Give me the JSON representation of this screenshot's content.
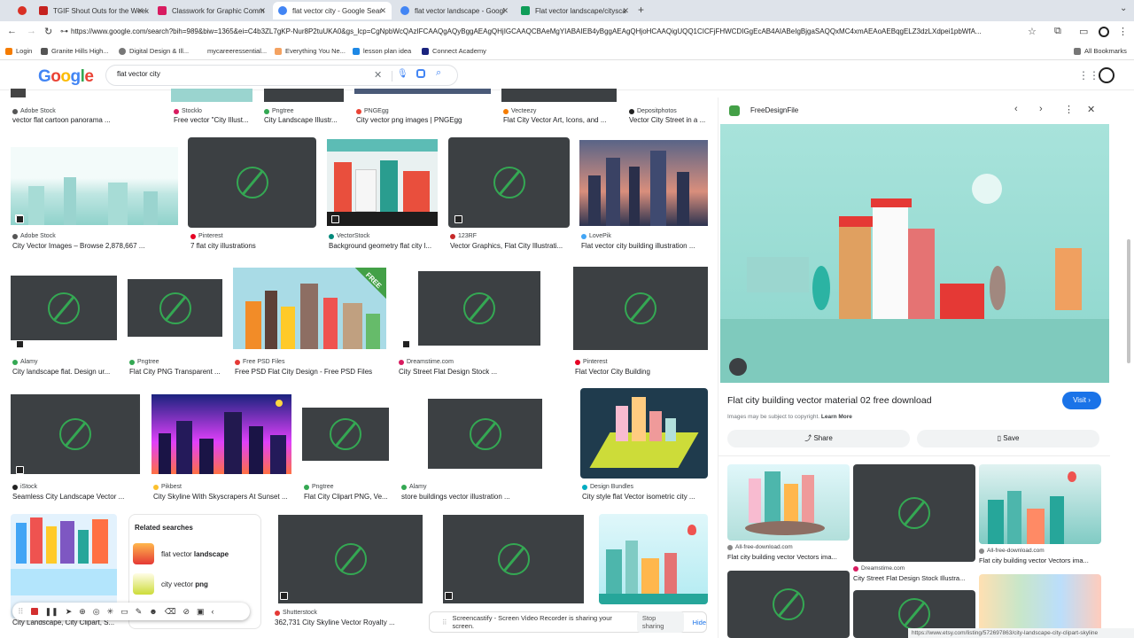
{
  "tabs": [
    {
      "label": "",
      "color": "#d93025"
    },
    {
      "label": "TGIF Shout Outs for the Week",
      "color": "#c5221f"
    },
    {
      "label": "Classwork for Graphic Comm",
      "color": "#d81b60"
    },
    {
      "label": "flat vector city - Google Sear",
      "color": "#4285f4"
    },
    {
      "label": "flat vector landscape - Googl",
      "color": "#4285f4"
    },
    {
      "label": "Flat vector landscape/citysca",
      "color": "#0f9d58"
    }
  ],
  "url": "https://www.google.com/search?bih=989&biw=1365&ei=C4b3ZL7gKP-Nur8P2tuUKA0&gs_lcp=CgNpbWcQAzIFCAAQgAQyBggAEAgQHjIGCAAQCBAeMgYIABAIEB4yBggAEAgQHjoHCAAQigUQQ1CICFjFHWCDIGgEcAB4AIABeIgBjgaSAQQxMC4xmAEAoAEBqgELZ3dzLXdpei1pbWfA...",
  "bookmarks": [
    "Login",
    "Granite Hills High...",
    "Digital Design & Ill...",
    "mycareeressential...",
    "Everything You Ne...",
    "lesson plan idea",
    "Connect Academy",
    "All Bookmarks"
  ],
  "google": {
    "logo": "Google",
    "query": "flat vector city"
  },
  "row0": [
    {
      "src": "Adobe Stock",
      "title": "vector flat cartoon panorama ..."
    },
    {
      "src": "Stocklo",
      "title": "Free vector \"City Illust..."
    },
    {
      "src": "Pngtree",
      "title": "City Landscape Illustr..."
    },
    {
      "src": "PNGEgg",
      "title": "City vector png images | PNGEgg"
    },
    {
      "src": "Vecteezy",
      "title": "Flat City Vector Art, Icons, and ..."
    },
    {
      "src": "Depositphotos",
      "title": "Vector City Street in a ..."
    }
  ],
  "row1": [
    {
      "src": "Adobe Stock",
      "title": "City Vector Images – Browse 2,878,667 ..."
    },
    {
      "src": "Pinterest",
      "title": "7 flat city illustrations"
    },
    {
      "src": "VectorStock",
      "title": "Background geometry flat city l..."
    },
    {
      "src": "123RF",
      "title": "Vector Graphics, Flat City Illustrati..."
    },
    {
      "src": "LovePik",
      "title": "Flat vector city building illustration ..."
    }
  ],
  "row2": [
    {
      "src": "Alamy",
      "title": "City landscape flat. Design ur..."
    },
    {
      "src": "Pngtree",
      "title": "Flat City PNG Transparent ..."
    },
    {
      "src": "Free PSD Files",
      "title": "Free PSD Flat City Design - Free PSD Files"
    },
    {
      "src": "Dreamstime.com",
      "title": "City Street Flat Design Stock ..."
    },
    {
      "src": "Pinterest",
      "title": "Flat Vector City Building"
    }
  ],
  "row3": [
    {
      "src": "iStock",
      "title": "Seamless City Landscape Vector ..."
    },
    {
      "src": "Pikbest",
      "title": "City Skyline With Skyscrapers At Sunset ..."
    },
    {
      "src": "Pngtree",
      "title": "Flat City Clipart PNG, Ve..."
    },
    {
      "src": "Alamy",
      "title": "store buildings vector illustration ..."
    },
    {
      "src": "Design Bundles",
      "title": "City style flat Vector isometric city ..."
    }
  ],
  "row4": [
    {
      "title": "City Landscape, City Clipart, S..."
    },
    {
      "src": "Shutterstock",
      "title": "362,731 City Skyline Vector Royalty ..."
    }
  ],
  "related": {
    "heading": "Related searches",
    "items": [
      {
        "prefix": "flat vector ",
        "bold": "landscape"
      },
      {
        "prefix": "city vector ",
        "bold": "png"
      }
    ]
  },
  "free_badge": "FREE",
  "panel": {
    "source": "FreeDesignFile",
    "title": "Flat city building vector material 02 free download",
    "visit": "Visit",
    "copyright": "Images may be subject to copyright.",
    "learn_more": "Learn More",
    "share": "Share",
    "save": "Save",
    "related": [
      {
        "src": "All-free-download.com",
        "title": "Flat city building vector Vectors ima..."
      },
      {
        "src": "Dreamstime.com",
        "title": "City Street Flat Design Stock Illustra..."
      },
      {
        "src": "All-free-download.com",
        "title": "Flat city building vector Vectors ima..."
      }
    ]
  },
  "recorder": {
    "banner": "Screencastify - Screen Video Recorder is sharing your screen.",
    "stop": "Stop sharing",
    "hide": "Hide"
  },
  "status_url": "https://www.etsy.com/listing/572697863/city-landscape-city-clipart-skyline"
}
